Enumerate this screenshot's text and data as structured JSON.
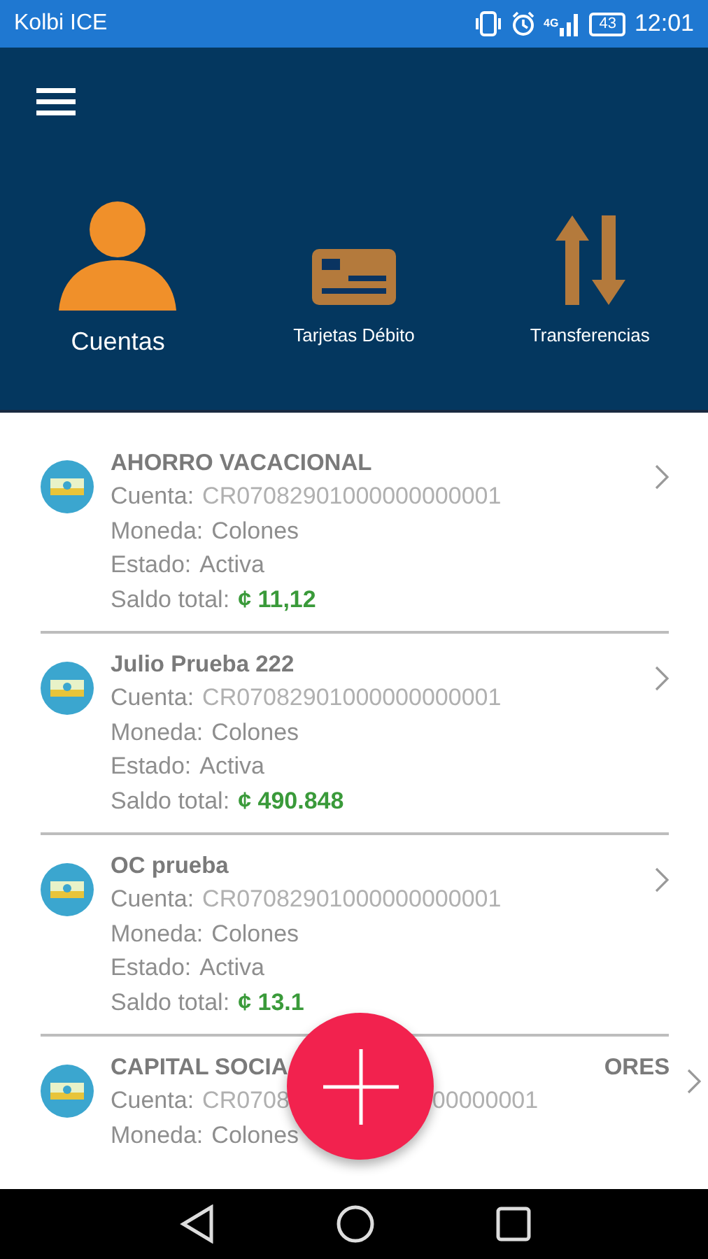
{
  "status_bar": {
    "carrier": "Kolbi ICE",
    "network": "4G",
    "battery": "43",
    "time": "12:01"
  },
  "tabs": [
    {
      "label": "Cuentas",
      "kind": "person",
      "selected": true
    },
    {
      "label": "Tarjetas Débito",
      "kind": "card",
      "selected": false
    },
    {
      "label": "Transferencias",
      "kind": "transfer",
      "selected": false
    }
  ],
  "accounts": [
    {
      "name": [
        "AHORRO VACACIONAL"
      ],
      "fields": [
        {
          "label": "Cuenta:",
          "value": [
            "CR07082901000000000001"
          ],
          "kind": "number"
        },
        {
          "label": "Moneda:",
          "value": [
            "Colones"
          ],
          "kind": "text"
        },
        {
          "label": "Estado:",
          "value": [
            "Activa"
          ],
          "kind": "text"
        },
        {
          "label": "Saldo total:",
          "value": [
            "¢ 11,12"
          ],
          "kind": "amount"
        }
      ]
    },
    {
      "name": [
        "Julio Prueba 222"
      ],
      "fields": [
        {
          "label": "Cuenta:",
          "value": [
            "CR07082901000000000001"
          ],
          "kind": "number"
        },
        {
          "label": "Moneda:",
          "value": [
            "Colones"
          ],
          "kind": "text"
        },
        {
          "label": "Estado:",
          "value": [
            "Activa"
          ],
          "kind": "text"
        },
        {
          "label": "Saldo total:",
          "value": [
            "¢ 490.848"
          ],
          "kind": "amount"
        }
      ]
    },
    {
      "name": [
        "OC prueba"
      ],
      "fields": [
        {
          "label": "Cuenta:",
          "value": [
            "CR07082901000000000001"
          ],
          "kind": "number"
        },
        {
          "label": "Moneda:",
          "value": [
            "Colones"
          ],
          "kind": "text"
        },
        {
          "label": "Estado:",
          "value": [
            "Activa"
          ],
          "kind": "text"
        },
        {
          "label": "Saldo total:",
          "value": [
            "¢ 13.1"
          ],
          "kind": "amount"
        }
      ]
    },
    {
      "name": [
        "CAPITAL SOCIA",
        "ORES"
      ],
      "fields": [
        {
          "label": "Cuenta:",
          "value": [
            "CR0708",
            "00000001"
          ],
          "kind": "number"
        },
        {
          "label": "Moneda:",
          "value": [
            "Colones"
          ],
          "kind": "text"
        }
      ]
    }
  ]
}
